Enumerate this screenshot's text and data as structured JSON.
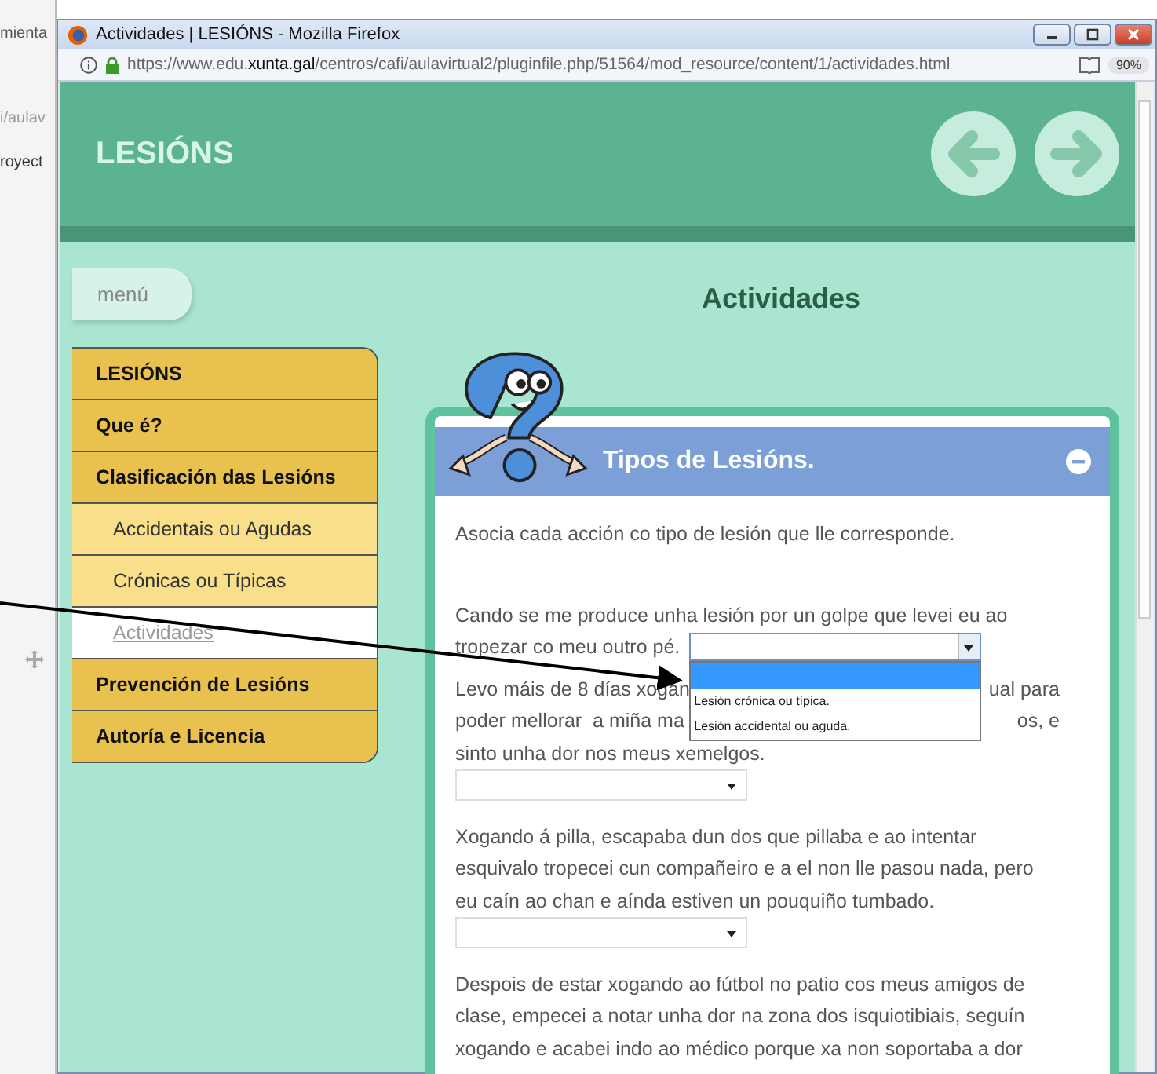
{
  "background_window": {
    "fragments": [
      "mienta",
      "i/aulav",
      "royect"
    ]
  },
  "window": {
    "title": "Actividades | LESIÓNS - Mozilla Firefox"
  },
  "address_bar": {
    "url_prefix": "https://www.edu.",
    "url_domain": "xunta.gal",
    "url_path": "/centros/cafi/aulavirtual2/pluginfile.php/51564/mod_resource/content/1/actividades.html",
    "zoom": "90%"
  },
  "header": {
    "title": "LESIÓNS"
  },
  "menu_button": "menú",
  "page_title": "Actividades",
  "sidebar": {
    "items": [
      {
        "label": "LESIÓNS",
        "kind": "section",
        "selected": false
      },
      {
        "label": "Que é?",
        "kind": "section",
        "selected": false
      },
      {
        "label": "Clasificación das Lesións",
        "kind": "section",
        "selected": false
      },
      {
        "label": "Accidentais ou Agudas",
        "kind": "subsection",
        "selected": false
      },
      {
        "label": "Crónicas ou Típicas",
        "kind": "subsection",
        "selected": false
      },
      {
        "label": "Actividades",
        "kind": "subsection",
        "selected": true
      },
      {
        "label": "Prevención de Lesións",
        "kind": "section",
        "selected": false
      },
      {
        "label": "Autoría e Licencia",
        "kind": "section",
        "selected": false
      }
    ]
  },
  "card": {
    "title": "Tipos de Lesións.",
    "instruction": "Asocia cada acción co tipo de lesión que lle corresponde.",
    "questions": [
      {
        "lines": [
          {
            "left": "Cando se me produce unha lesión por un golpe que levei eu ao"
          },
          {
            "left": "tropezar co meu outro pé."
          }
        ],
        "kind": "inline_dropdown",
        "open": true,
        "blank_option_highlighted": true,
        "options": [
          {
            "label": "Lesión crónica ou típica."
          },
          {
            "label": "Lesión accidental ou aguda."
          }
        ]
      },
      {
        "lines": [
          {
            "left": "Levo máis de 8 días xogan",
            "right": "ual para"
          },
          {
            "left": "poder mellorar  a miña ma",
            "right": "os, e"
          },
          {
            "left": "sinto unha dor nos meus xemelgos."
          }
        ],
        "kind": "dropdown_below"
      },
      {
        "lines": [
          {
            "left": "Xogando á pilla, escapaba dun dos que pillaba e ao intentar"
          },
          {
            "left": "esquivalo tropecei cun compañeiro e a el non lle pasou nada, pero"
          },
          {
            "left": "eu caín ao chan e aínda estiven un pouquiño tumbado."
          }
        ],
        "kind": "dropdown_below"
      },
      {
        "lines": [
          {
            "left": "Despois de estar xogando ao fútbol no patio cos meus amigos de"
          },
          {
            "left": "clase, empecei a notar unha dor na zona dos isquiotibiais, seguín"
          },
          {
            "left": "xogando e acabei indo ao médico porque xa non soportaba a dor"
          }
        ],
        "kind": "text_only"
      }
    ]
  }
}
